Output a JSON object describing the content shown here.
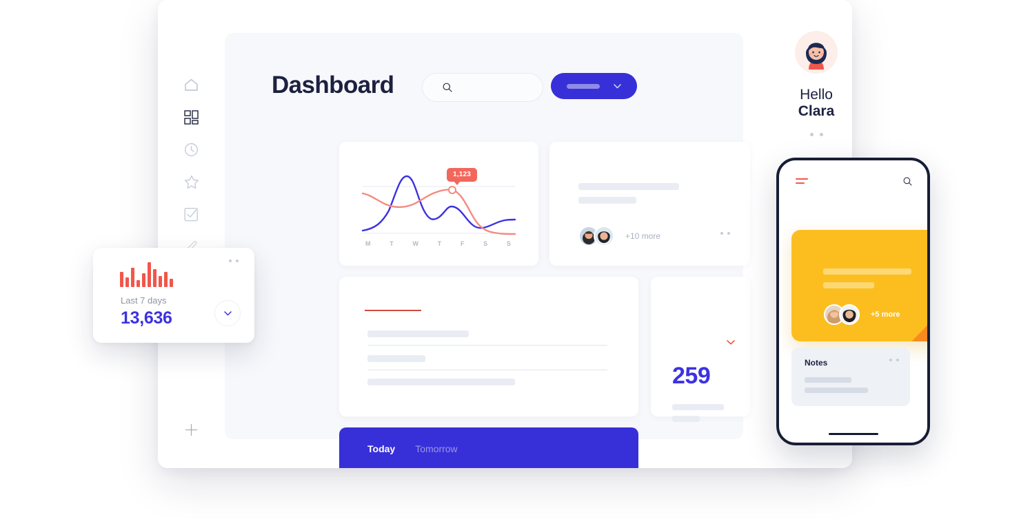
{
  "window": {
    "traffic_lights": [
      {
        "name": "close",
        "color": "#f7544d"
      },
      {
        "name": "minimize",
        "color": "#fdbe2f"
      },
      {
        "name": "maximize",
        "color": "#28c840"
      }
    ]
  },
  "sidebar": {
    "items": [
      {
        "id": "home",
        "icon": "home-icon",
        "active": false
      },
      {
        "id": "dashboard",
        "icon": "grid-icon",
        "active": true
      },
      {
        "id": "history",
        "icon": "clock-icon",
        "active": false
      },
      {
        "id": "favorites",
        "icon": "star-icon",
        "active": false
      },
      {
        "id": "tasks",
        "icon": "checkbox-icon",
        "active": false
      },
      {
        "id": "edit",
        "icon": "pencil-icon",
        "active": false
      }
    ],
    "add_icon": "plus-icon"
  },
  "header": {
    "title": "Dashboard",
    "search": {
      "placeholder": "",
      "value": "",
      "icon": "search-icon"
    },
    "primary_button": {
      "label": "",
      "icon": "chevron-down-icon",
      "color": "#3730d8"
    }
  },
  "chart_card": {
    "tooltip_value": "1,123",
    "day_labels": [
      "M",
      "T",
      "W",
      "T",
      "F",
      "S",
      "S"
    ]
  },
  "chart_data": {
    "type": "line",
    "title": "",
    "xlabel": "",
    "ylabel": "",
    "categories": [
      "M",
      "T",
      "W",
      "T",
      "F",
      "S",
      "S"
    ],
    "annotation": {
      "label": "1,123",
      "at_category": "T",
      "series": "coral"
    },
    "grid": true,
    "legend": "none",
    "ylim": [
      0,
      1600
    ],
    "series": [
      {
        "name": "blue",
        "color": "#3c32e0",
        "values": [
          250,
          1250,
          420,
          900,
          400,
          380,
          620
        ]
      },
      {
        "name": "coral",
        "color": "#f58a80",
        "values": [
          960,
          700,
          900,
          1123,
          520,
          210,
          190
        ]
      }
    ]
  },
  "people_card": {
    "more_label": "+10 more",
    "menu_icon": "two-dots-icon",
    "avatars": [
      "avatar-man",
      "avatar-woman"
    ]
  },
  "list_card": {
    "accent_color": "#d14b3e"
  },
  "stat_card": {
    "value": "259",
    "chevron_icon": "chevron-down-icon",
    "chevron_color": "#f2564a"
  },
  "tabbar": {
    "tabs": [
      {
        "label": "Today",
        "active": true
      },
      {
        "label": "Tomorrow",
        "active": false
      }
    ]
  },
  "greeting": {
    "hello": "Hello",
    "name": "Clara",
    "avatar": "avatar-clara-illustration",
    "pager_dots": 2
  },
  "float_card": {
    "label": "Last 7 days",
    "value": "13,636",
    "menu_icon": "two-dots-icon",
    "expand_icon": "chevron-down-icon",
    "bar_color": "#f2564a",
    "bars": [
      22,
      14,
      28,
      10,
      20,
      36,
      26,
      16,
      22,
      12
    ]
  },
  "phone": {
    "menu_icon": "hamburger-icon",
    "menu_color": "#f2564a",
    "search_icon": "search-icon",
    "yellow_card": {
      "color": "#fcbe1f",
      "blob_color": "#f98a1f",
      "more_label": "+5 more",
      "menu_icon": "two-dots-icon",
      "avatars": [
        "avatar-woman-blonde",
        "avatar-woman-dark"
      ]
    },
    "notes_card": {
      "title": "Notes",
      "menu_icon": "two-dots-icon"
    },
    "home_indicator": true
  }
}
